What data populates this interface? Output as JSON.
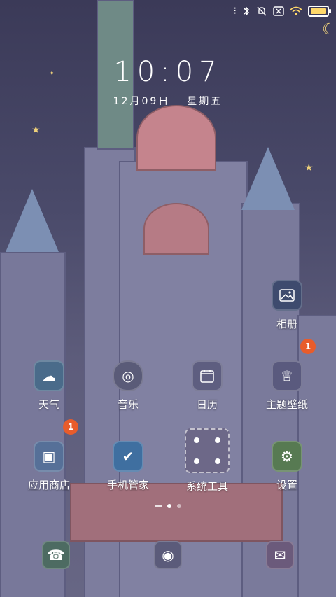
{
  "status_bar": {
    "icons": [
      "dots-icon",
      "bluetooth-icon",
      "mute-icon",
      "close-box-icon",
      "wifi-icon",
      "battery-icon"
    ],
    "battery_level": 0.95
  },
  "clock": {
    "time": "10:07",
    "date_month_day": "12月09日",
    "weekday": "星期五"
  },
  "apps": [
    {
      "name": "相册",
      "icon": "photos-icon"
    },
    {
      "name": "天气",
      "icon": "weather-icon"
    },
    {
      "name": "音乐",
      "icon": "music-icon"
    },
    {
      "name": "日历",
      "icon": "calendar-icon"
    },
    {
      "name": "主题壁纸",
      "icon": "theme-icon",
      "badge": "1"
    },
    {
      "name": "应用商店",
      "icon": "appstore-icon",
      "badge": "1"
    },
    {
      "name": "手机管家",
      "icon": "security-icon"
    },
    {
      "name": "系统工具",
      "icon": "folder-icon"
    },
    {
      "name": "设置",
      "icon": "settings-icon"
    }
  ],
  "pager": {
    "pages": 2,
    "active": 0
  },
  "dock": [
    {
      "icon": "phone-icon"
    },
    {
      "icon": "camera-icon"
    },
    {
      "icon": "messages-icon"
    }
  ],
  "colors": {
    "badge": "#e85c2b",
    "accent": "#ffd86a"
  }
}
